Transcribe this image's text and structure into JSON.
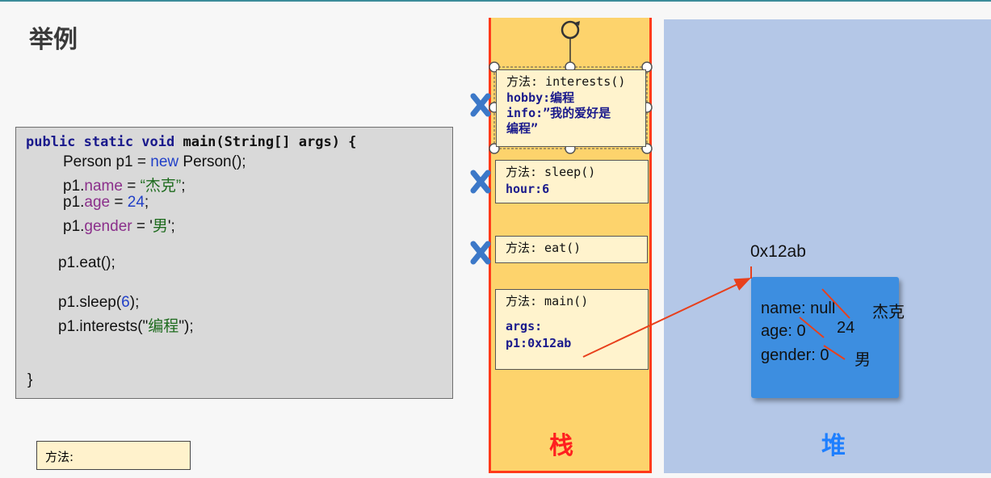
{
  "slide": {
    "title": "举例"
  },
  "code": {
    "signature_kw": "public static void",
    "signature_rest": " main(String[] args) {",
    "line1_a": "Person p1 = ",
    "line1_new": "new",
    "line1_b": " Person();",
    "p1": "p1.",
    "name_field": "name",
    "name_eq": " = ",
    "name_val": "“杰克”",
    "name_end": ";",
    "age_field": "age",
    "age_eq": " = ",
    "age_val": "24",
    "age_end": ";",
    "gender_field": "gender",
    "gender_eq": " = '",
    "gender_val": "男",
    "gender_end": "';",
    "eat_call": "p1.eat();",
    "sleep_a": "p1.sleep(",
    "sleep_arg": "6",
    "sleep_b": ");",
    "interests_a": "p1.interests(\"",
    "interests_arg": "编程",
    "interests_b": "\");",
    "closing_brace": "}"
  },
  "method_label_box": {
    "text": "方法:"
  },
  "stack": {
    "label": "栈",
    "frames": {
      "interests": {
        "method": "方法: interests()",
        "hobby": "hobby:编程",
        "info_1": "info:”我的爱好是",
        "info_2": "编程”"
      },
      "sleep": {
        "method": "方法: sleep()",
        "hour": "hour:6"
      },
      "eat": {
        "method": "方法: eat()"
      },
      "main": {
        "method": "方法: main()",
        "args": "args:",
        "p1": "p1:0x12ab"
      }
    }
  },
  "heap": {
    "label": "堆",
    "address": "0x12ab",
    "object": {
      "name_line": "name: null",
      "name_new": "杰克",
      "age_line": "age: 0",
      "age_new": "24",
      "gender_line": "gender: 0",
      "gender_new": "男"
    }
  },
  "colors": {
    "stack_fill": "#fdd36c",
    "stack_border": "#ff3a1a",
    "heap_fill": "#b4c7e7",
    "object_fill": "#3d8ee0",
    "arrow": "#e8401c",
    "pop_marker": "#2e75b6"
  }
}
